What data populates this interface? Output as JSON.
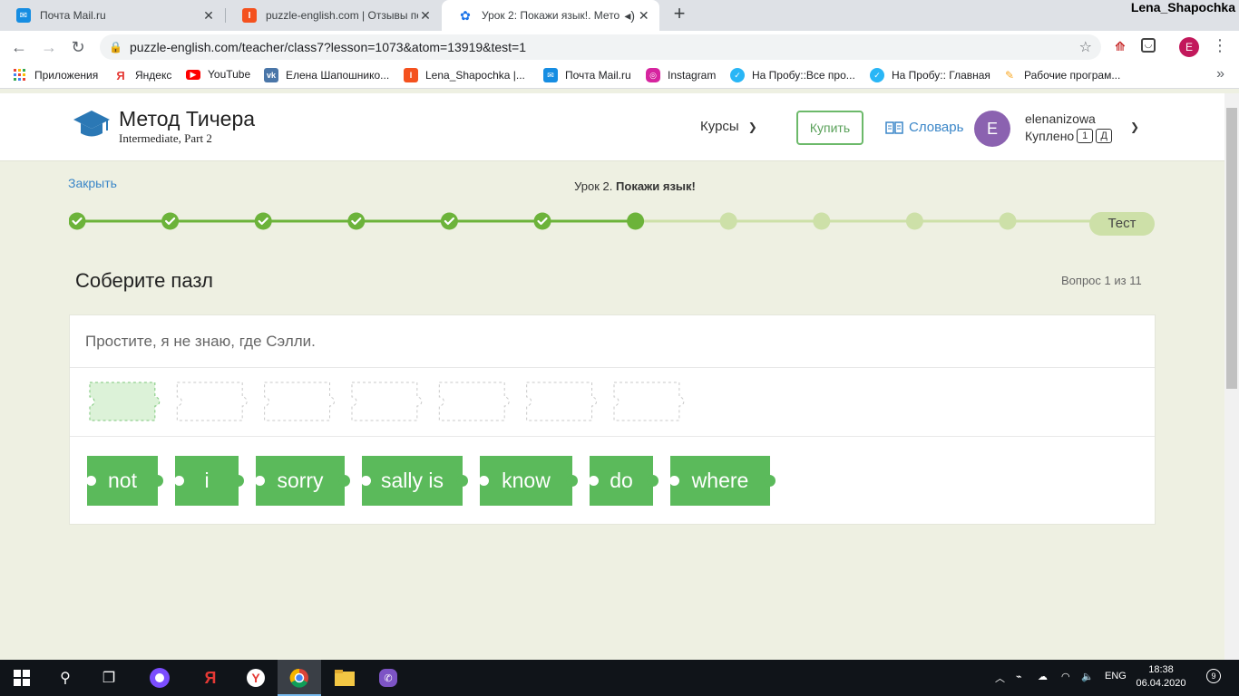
{
  "browser": {
    "tabs": [
      {
        "label": "Почта Mail.ru",
        "icon": "mail-icon",
        "active": false
      },
      {
        "label": "puzzle-english.com | Отзывы по",
        "icon": "irecommend-icon",
        "active": false
      },
      {
        "label": "Урок 2: Покажи язык!. Мето",
        "icon": "gear-icon",
        "active": true
      }
    ],
    "corner_user": "Lena_Shapochka",
    "url": "puzzle-english.com/teacher/class7?lesson=1073&atom=13919&test=1",
    "profile_letter": "E",
    "bookmarks": [
      {
        "label": "Приложения",
        "icon": "apps-icon",
        "color": "#1a73e8"
      },
      {
        "label": "Яндекс",
        "icon": "yandex-icon",
        "color": "#e53935"
      },
      {
        "label": "YouTube",
        "icon": "youtube-icon",
        "color": "#ff0000"
      },
      {
        "label": "Елена Шапошнико...",
        "icon": "vk-icon",
        "color": "#4a76a8"
      },
      {
        "label": "Lena_Shapochka |...",
        "icon": "irecommend-icon",
        "color": "#f4511e"
      },
      {
        "label": "Почта Mail.ru",
        "icon": "mail-icon",
        "color": "#168de2"
      },
      {
        "label": "Instagram",
        "icon": "instagram-icon",
        "color": "#d6249f"
      },
      {
        "label": "На Пробу::Все про...",
        "icon": "naprobu-icon",
        "color": "#29b6f6"
      },
      {
        "label": "На Пробу:: Главная",
        "icon": "naprobu-icon",
        "color": "#29b6f6"
      },
      {
        "label": "Рабочие програм...",
        "icon": "pencil-icon",
        "color": "#f9a825"
      }
    ]
  },
  "header": {
    "logo_title": "Метод Тичера",
    "logo_subtitle": "Intermediate, Part 2",
    "courses_label": "Курсы",
    "buy_label": "Купить",
    "dictionary_label": "Словарь",
    "avatar_letter": "E",
    "username": "elenanizowa",
    "purchased_label": "Куплено",
    "badges": [
      "1",
      "Д"
    ]
  },
  "lesson": {
    "close_label": "Закрыть",
    "title_prefix": "Урок 2.",
    "title_name": "Покажи язык!",
    "steps_total": 11,
    "steps_done": 6,
    "current_step": 7,
    "test_label": "Тест"
  },
  "exercise": {
    "title": "Соберите пазл",
    "counter": "Вопрос 1 из 11",
    "prompt": "Простите, я не знаю, где Сэлли.",
    "slot_count": 7,
    "active_slot": 1,
    "pieces": [
      "not",
      "i",
      "sorry",
      "sally is",
      "know",
      "do",
      "where"
    ]
  },
  "taskbar": {
    "language": "ENG",
    "time": "18:38",
    "date": "06.04.2020"
  },
  "colors": {
    "accent_green": "#5bba5b",
    "progress_done": "#6cb33a",
    "progress_todo": "#cde0a8",
    "link_blue": "#3a86c8",
    "page_bg": "#eef0e2"
  }
}
